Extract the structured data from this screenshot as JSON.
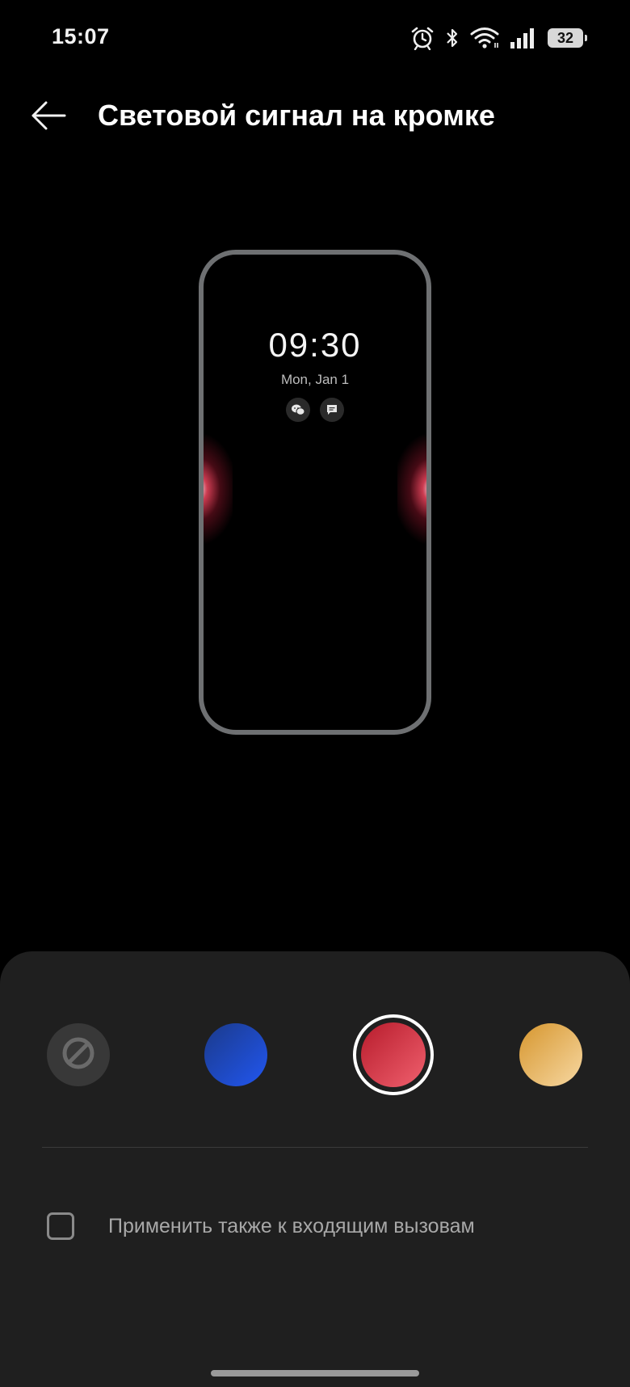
{
  "status_bar": {
    "time": "15:07",
    "battery_level": "32",
    "icons": [
      "alarm-icon",
      "bluetooth-icon",
      "wifi-icon",
      "signal-icon",
      "battery-icon"
    ]
  },
  "header": {
    "back_icon": "arrow-left-icon",
    "title": "Световой сигнал на кромке"
  },
  "preview": {
    "clock": "09:30",
    "date": "Mon, Jan 1",
    "notification_icons": [
      "wechat-icon",
      "message-icon"
    ],
    "glow_color": "#f0465f"
  },
  "colors": {
    "options": [
      {
        "name": "none",
        "icon": "disabled-icon",
        "color": "#383838",
        "selected": false
      },
      {
        "name": "blue",
        "color": "#2156f0",
        "selected": false
      },
      {
        "name": "red",
        "color": "#e04050",
        "selected": true
      },
      {
        "name": "gold",
        "color": "#e8b060",
        "selected": false
      }
    ]
  },
  "option": {
    "label": "Применить также к входящим вызовам",
    "checked": false
  }
}
